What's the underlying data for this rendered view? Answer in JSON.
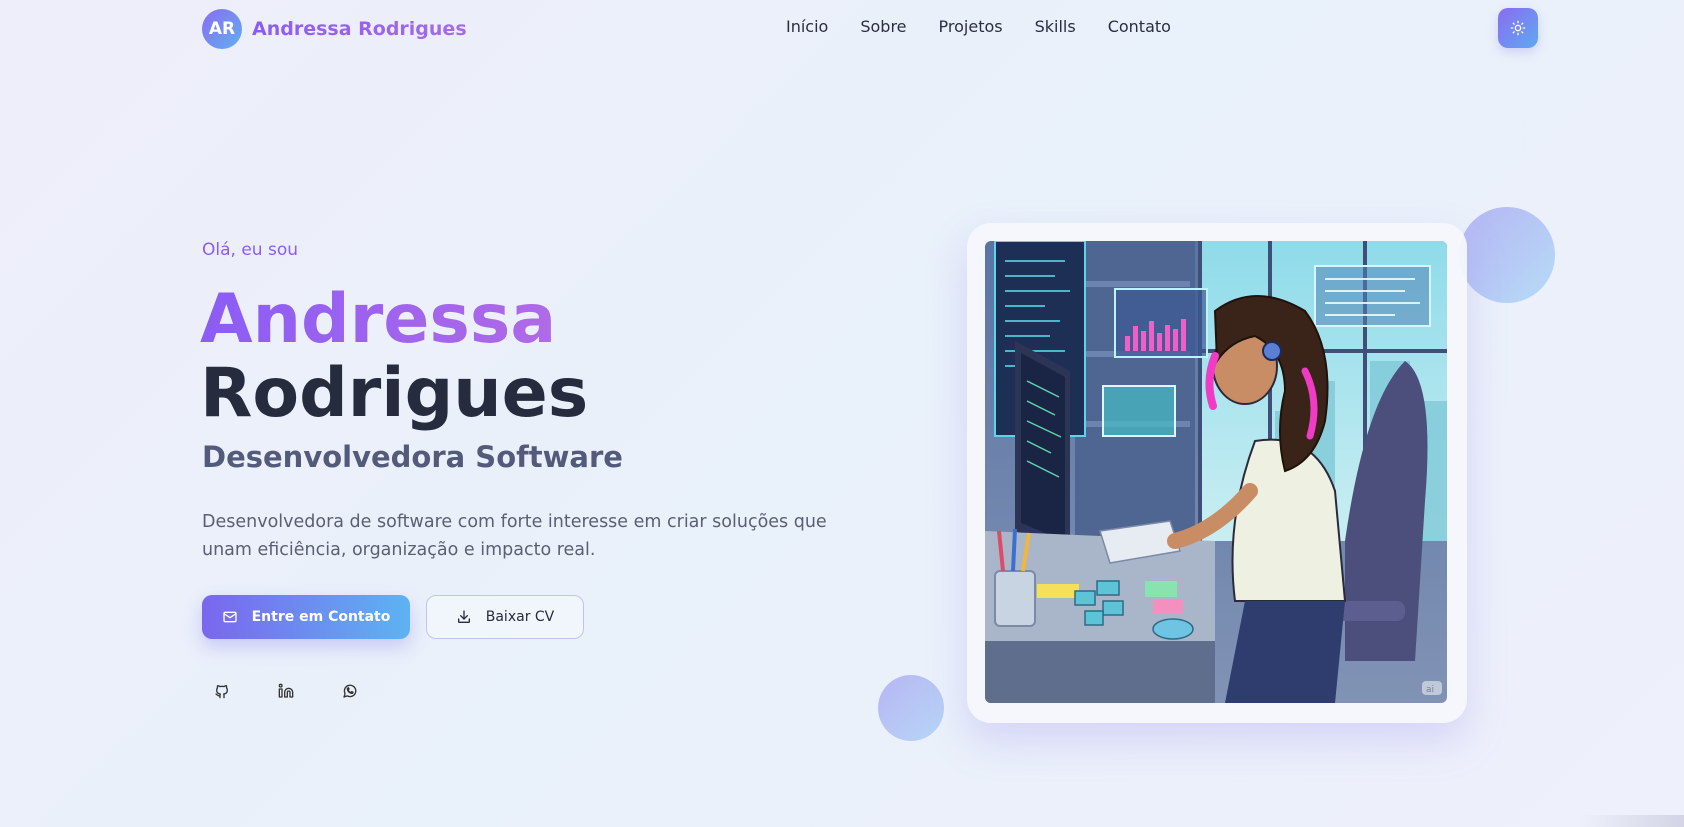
{
  "nav": {
    "logo_initials": "AR",
    "brand_name": "Andressa Rodrigues",
    "menu": [
      "Início",
      "Sobre",
      "Projetos",
      "Skills",
      "Contato"
    ],
    "theme_toggle_icon": "sun-icon"
  },
  "hero": {
    "greeting": "Olá, eu sou",
    "first_name": "Andressa",
    "last_name": "Rodrigues",
    "role": "Desenvolvedora Software",
    "description": "Desenvolvedora de software com forte interesse em criar soluções que unam eficiência, organização e impacto real.",
    "primary_button": "Entre em Contato",
    "primary_button_icon": "mail-icon",
    "secondary_button": "Baixar CV",
    "secondary_button_icon": "download-icon",
    "socials": [
      {
        "icon": "github-icon"
      },
      {
        "icon": "linkedin-icon"
      },
      {
        "icon": "whatsapp-icon"
      }
    ]
  },
  "image": {
    "subject": "illustration-developer-at-desk",
    "watermark": "ai"
  },
  "colors": {
    "accent_purple": "#8b5cf6",
    "accent_blue": "#5db3f2",
    "text_dark": "#272b3e",
    "text_muted": "#5a5f72"
  }
}
